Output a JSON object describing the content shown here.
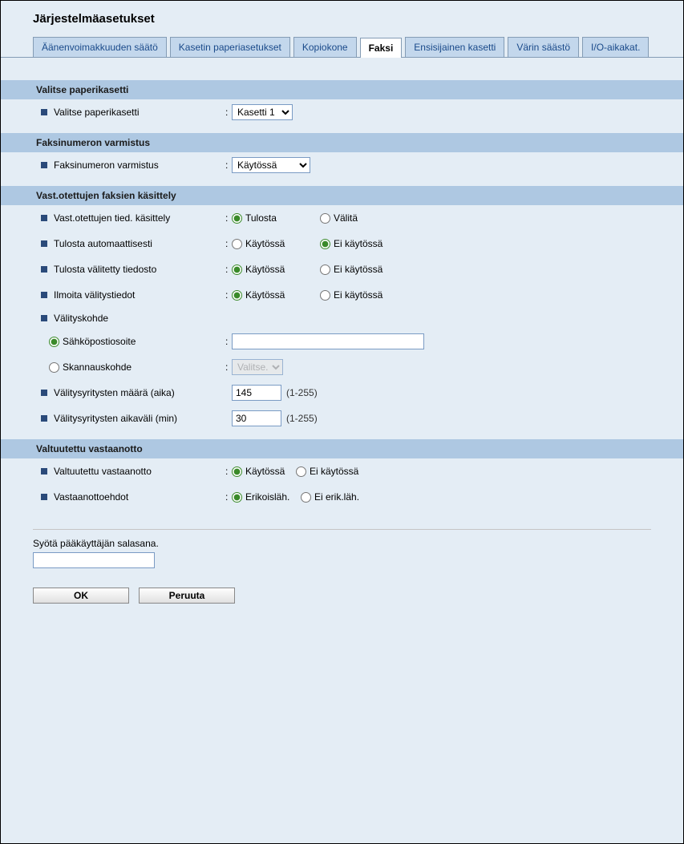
{
  "page_title": "Järjestelmäasetukset",
  "tabs": [
    {
      "label": "Äänenvoimakkuuden säätö"
    },
    {
      "label": "Kasetin paperiasetukset"
    },
    {
      "label": "Kopiokone"
    },
    {
      "label": "Faksi"
    },
    {
      "label": "Ensisijainen kasetti"
    },
    {
      "label": "Värin säästö"
    },
    {
      "label": "I/O-aikakat."
    }
  ],
  "sections": {
    "valitse_paperikasetti": {
      "header": "Valitse paperikasetti",
      "row_label": "Valitse paperikasetti",
      "selected": "Kasetti 1"
    },
    "faksinumeron": {
      "header": "Faksinumeron varmistus",
      "row_label": "Faksinumeron varmistus",
      "selected": "Käytössä"
    },
    "vastotettujen": {
      "header": "Vast.otettujen faksien käsittely",
      "r1_label": "Vast.otettujen tied. käsittely",
      "r1_opt1": "Tulosta",
      "r1_opt2": "Välitä",
      "r2_label": "Tulosta automaattisesti",
      "r2_opt1": "Käytössä",
      "r2_opt2": "Ei käytössä",
      "r3_label": "Tulosta välitetty tiedosto",
      "r3_opt1": "Käytössä",
      "r3_opt2": "Ei käytössä",
      "r4_label": "Ilmoita välitystiedot",
      "r4_opt1": "Käytössä",
      "r4_opt2": "Ei käytössä",
      "r5_label": "Välityskohde",
      "r5a_label": "Sähköpostiosoite",
      "r5a_value": "",
      "r5b_label": "Skannauskohde",
      "r5b_selected": "Valitse.",
      "r6_label": "Välitysyritysten määrä (aika)",
      "r6_value": "145",
      "r6_hint": "(1-255)",
      "r7_label": "Välitysyritysten aikaväli (min)",
      "r7_value": "30",
      "r7_hint": "(1-255)"
    },
    "valtuutettu": {
      "header": "Valtuutettu vastaanotto",
      "r1_label": "Valtuutettu vastaanotto",
      "r1_opt1": "Käytössä",
      "r1_opt2": "Ei käytössä",
      "r2_label": "Vastaanottoehdot",
      "r2_opt1": "Erikoisläh.",
      "r2_opt2": "Ei erik.läh."
    }
  },
  "pw_label": "Syötä pääkäyttäjän salasana.",
  "buttons": {
    "ok": "OK",
    "cancel": "Peruuta"
  }
}
